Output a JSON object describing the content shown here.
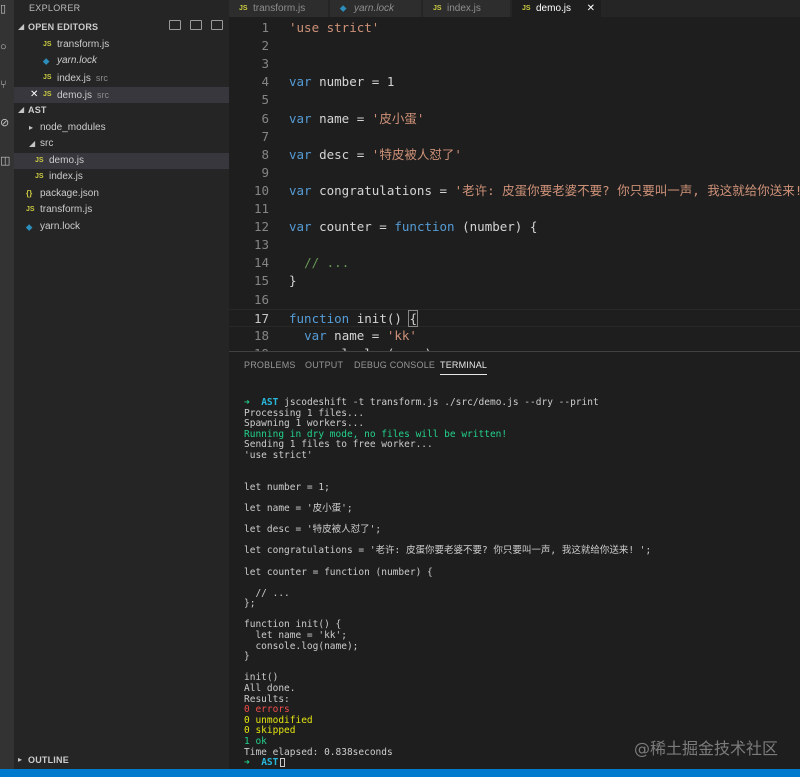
{
  "activity_bar": {
    "icons": [
      "explorer-icon",
      "search-icon",
      "source-control-icon",
      "debug-icon",
      "extensions-icon"
    ]
  },
  "sidebar": {
    "title": "EXPLORER",
    "open_editors": {
      "label": "OPEN EDITORS",
      "items": [
        {
          "icon": "JS",
          "name": "transform.js",
          "desc": ""
        },
        {
          "icon": "yarn-icon",
          "name": "yarn.lock",
          "desc": ""
        },
        {
          "icon": "JS",
          "name": "index.js",
          "desc": "src"
        },
        {
          "icon": "JS",
          "name": "demo.js",
          "desc": "src"
        }
      ]
    },
    "folder": {
      "label": "AST",
      "items": [
        {
          "name": "node_modules"
        },
        {
          "name": "src"
        },
        {
          "icon": "JS",
          "name": "demo.js"
        },
        {
          "icon": "JS",
          "name": "index.js"
        },
        {
          "icon": "{}",
          "name": "package.json"
        },
        {
          "icon": "JS",
          "name": "transform.js"
        },
        {
          "icon": "yarn-icon",
          "name": "yarn.lock"
        }
      ]
    },
    "outline": {
      "label": "OUTLINE"
    }
  },
  "tabs": [
    {
      "icon": "JS",
      "label": "transform.js",
      "active": false
    },
    {
      "icon": "yarn-icon",
      "label": "yarn.lock",
      "active": false
    },
    {
      "icon": "JS",
      "label": "index.js",
      "active": false
    },
    {
      "icon": "JS",
      "label": "demo.js",
      "active": true
    }
  ],
  "close_glyph": "✕",
  "editor": {
    "current_line": 17,
    "lines": [
      {
        "n": "1",
        "tokens": [
          [
            "str",
            "'use strict'"
          ]
        ]
      },
      {
        "n": "2",
        "tokens": []
      },
      {
        "n": "3",
        "tokens": []
      },
      {
        "n": "4",
        "tokens": [
          [
            "kw",
            "var"
          ],
          [
            "",
            " number = 1"
          ]
        ]
      },
      {
        "n": "5",
        "tokens": []
      },
      {
        "n": "6",
        "tokens": [
          [
            "kw",
            "var"
          ],
          [
            "",
            " name = "
          ],
          [
            "str",
            "'皮小蛋'"
          ]
        ]
      },
      {
        "n": "7",
        "tokens": []
      },
      {
        "n": "8",
        "tokens": [
          [
            "kw",
            "var"
          ],
          [
            "",
            " desc = "
          ],
          [
            "str",
            "'特皮被人怼了'"
          ]
        ]
      },
      {
        "n": "9",
        "tokens": []
      },
      {
        "n": "10",
        "tokens": [
          [
            "kw",
            "var"
          ],
          [
            "",
            " congratulations = "
          ],
          [
            "str",
            "'老许: 皮蛋你要老婆不要? 你只要叫一声, 我这就给你送来! '"
          ]
        ]
      },
      {
        "n": "11",
        "tokens": []
      },
      {
        "n": "12",
        "tokens": [
          [
            "kw",
            "var"
          ],
          [
            "",
            " counter = "
          ],
          [
            "kw",
            "function"
          ],
          [
            "",
            " (number) {"
          ]
        ]
      },
      {
        "n": "13",
        "tokens": []
      },
      {
        "n": "14",
        "tokens": [
          [
            "",
            "  "
          ],
          [
            "cm",
            "// ..."
          ]
        ]
      },
      {
        "n": "15",
        "tokens": [
          [
            "",
            "}"
          ]
        ]
      },
      {
        "n": "16",
        "tokens": []
      },
      {
        "n": "17",
        "tokens": [
          [
            "kw",
            "function"
          ],
          [
            "",
            " init() "
          ],
          [
            "br",
            "{"
          ]
        ]
      },
      {
        "n": "18",
        "tokens": [
          [
            "",
            "  "
          ],
          [
            "kw",
            "var"
          ],
          [
            "",
            " name = "
          ],
          [
            "str",
            "'kk'"
          ]
        ]
      },
      {
        "n": "19",
        "tokens": [
          [
            "",
            "  console.log(name)"
          ]
        ]
      }
    ]
  },
  "panel": {
    "tabs": [
      "PROBLEMS",
      "OUTPUT",
      "DEBUG CONSOLE",
      "TERMINAL"
    ],
    "active_tab": "TERMINAL",
    "terminal": {
      "prompt_arrow": "➜",
      "prompt_dir": "AST",
      "command": "jscodeshift -t transform.js ./src/demo.js --dry --print",
      "lines": [
        {
          "style": "",
          "text": "Processing 1 files..."
        },
        {
          "style": "",
          "text": "Spawning 1 workers..."
        },
        {
          "style": "green",
          "text": "Running in dry mode, no files will be written!"
        },
        {
          "style": "",
          "text": "Sending 1 files to free worker..."
        },
        {
          "style": "",
          "text": "'use strict'"
        },
        {
          "style": "",
          "text": ""
        },
        {
          "style": "",
          "text": ""
        },
        {
          "style": "",
          "text": "let number = 1;"
        },
        {
          "style": "",
          "text": ""
        },
        {
          "style": "",
          "text": "let name = '皮小蛋';"
        },
        {
          "style": "",
          "text": ""
        },
        {
          "style": "",
          "text": "let desc = '特皮被人怼了';"
        },
        {
          "style": "",
          "text": ""
        },
        {
          "style": "",
          "text": "let congratulations = '老许: 皮蛋你要老婆不要? 你只要叫一声, 我这就给你送来! ';"
        },
        {
          "style": "",
          "text": ""
        },
        {
          "style": "",
          "text": "let counter = function (number) {"
        },
        {
          "style": "",
          "text": ""
        },
        {
          "style": "",
          "text": "  // ..."
        },
        {
          "style": "",
          "text": "};"
        },
        {
          "style": "",
          "text": ""
        },
        {
          "style": "",
          "text": "function init() {"
        },
        {
          "style": "",
          "text": "  let name = 'kk';"
        },
        {
          "style": "",
          "text": "  console.log(name);"
        },
        {
          "style": "",
          "text": "}"
        },
        {
          "style": "",
          "text": ""
        },
        {
          "style": "",
          "text": "init()"
        },
        {
          "style": "",
          "text": "All done."
        },
        {
          "style": "",
          "text": "Results:"
        },
        {
          "style": "red",
          "text": "0 errors"
        },
        {
          "style": "yellow",
          "text": "0 unmodified"
        },
        {
          "style": "yellow",
          "text": "0 skipped"
        },
        {
          "style": "green",
          "text": "1 ok"
        },
        {
          "style": "",
          "text": "Time elapsed: 0.838seconds"
        }
      ]
    }
  },
  "watermark": "@稀土掘金技术社区",
  "colors": {
    "status_bar": "#007acc",
    "keyword": "#569cd6",
    "string": "#ce9178",
    "comment": "#6a9955"
  }
}
